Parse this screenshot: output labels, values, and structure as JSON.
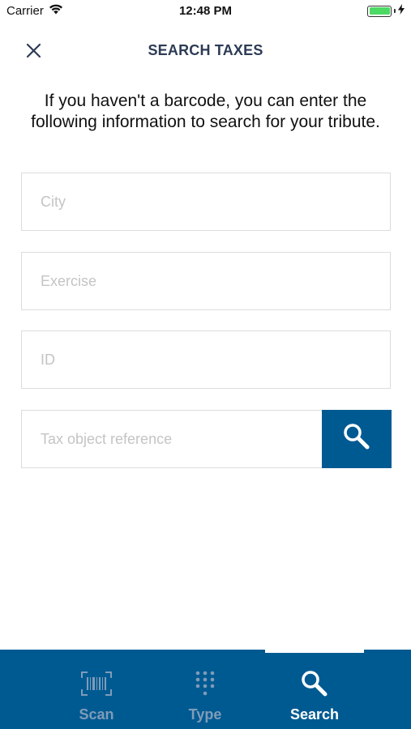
{
  "status_bar": {
    "carrier": "Carrier",
    "time": "12:48 PM",
    "battery_color": "#4cd964"
  },
  "header": {
    "title": "SEARCH TAXES",
    "close_icon": "close-icon"
  },
  "intro_text": "If you haven't a barcode, you can enter the following information to search for your tribute.",
  "form": {
    "city": {
      "placeholder": "City",
      "value": ""
    },
    "exercise": {
      "placeholder": "Exercise",
      "value": ""
    },
    "id": {
      "placeholder": "ID",
      "value": ""
    },
    "tax_object_reference": {
      "placeholder": "Tax object reference",
      "value": ""
    },
    "search_button_icon": "search-icon"
  },
  "tab_bar": {
    "tabs": [
      {
        "label": "Scan",
        "icon": "barcode-icon",
        "active": false
      },
      {
        "label": "Type",
        "icon": "keypad-icon",
        "active": false
      },
      {
        "label": "Search",
        "icon": "search-icon",
        "active": true
      }
    ]
  },
  "colors": {
    "primary": "#005a92",
    "title": "#2d3b55",
    "field_border": "#dcdcdc",
    "placeholder": "#c4c4c4",
    "tab_inactive": "#7f9cb8"
  }
}
